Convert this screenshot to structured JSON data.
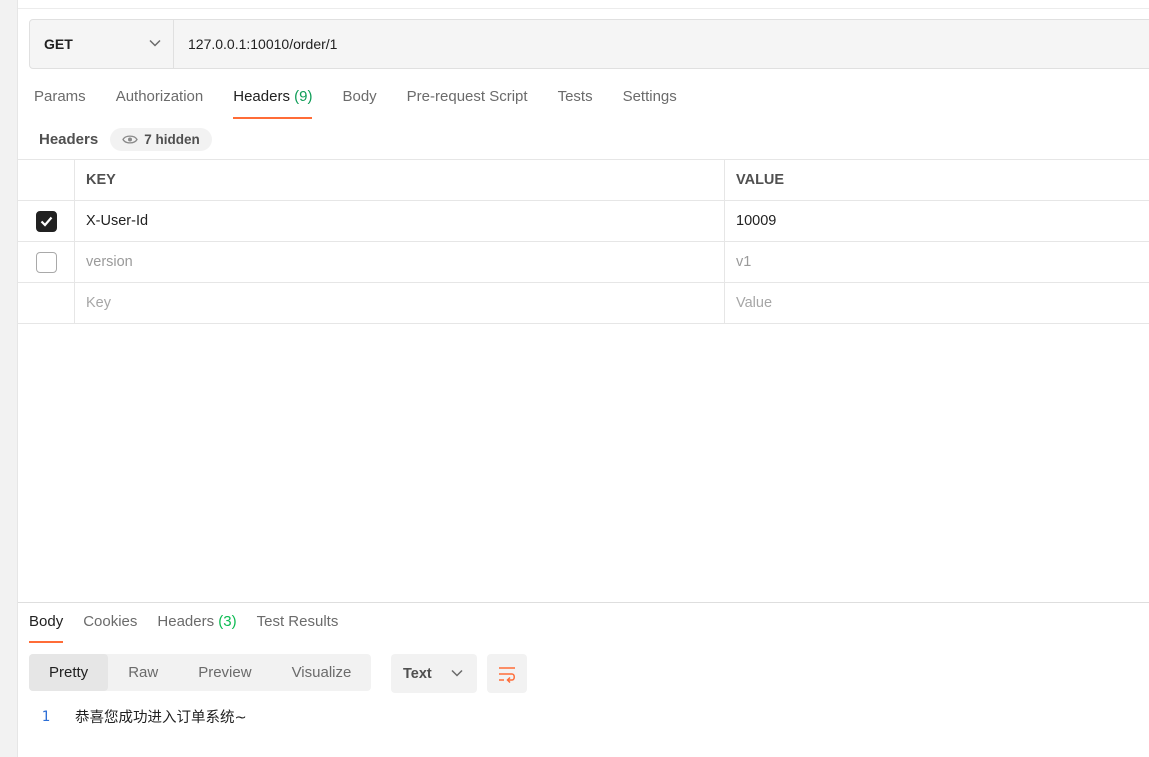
{
  "request": {
    "method": "GET",
    "url": "127.0.0.1:10010/order/1"
  },
  "request_tabs": [
    {
      "label": "Params",
      "count": ""
    },
    {
      "label": "Authorization",
      "count": ""
    },
    {
      "label": "Headers",
      "count": "(9)"
    },
    {
      "label": "Body",
      "count": ""
    },
    {
      "label": "Pre-request Script",
      "count": ""
    },
    {
      "label": "Tests",
      "count": ""
    },
    {
      "label": "Settings",
      "count": ""
    }
  ],
  "active_request_tab": "Headers",
  "headers_section": {
    "title": "Headers",
    "hidden_label": "7 hidden"
  },
  "headers_table": {
    "columns": [
      "KEY",
      "VALUE"
    ],
    "rows": [
      {
        "checked": true,
        "key": "X-User-Id",
        "value": "10009"
      },
      {
        "checked": false,
        "key": "version",
        "value": "v1"
      }
    ],
    "placeholders": {
      "key": "Key",
      "value": "Value"
    }
  },
  "response_tabs": [
    {
      "label": "Body",
      "count": ""
    },
    {
      "label": "Cookies",
      "count": ""
    },
    {
      "label": "Headers",
      "count": "(3)"
    },
    {
      "label": "Test Results",
      "count": ""
    }
  ],
  "view_modes": [
    "Pretty",
    "Raw",
    "Preview",
    "Visualize"
  ],
  "active_view_mode": "Pretty",
  "format": "Text",
  "response_body": {
    "line_number": "1",
    "text": "恭喜您成功进入订单系统~"
  },
  "colors": {
    "accent": "#ff6c37",
    "count_green": "#0cbb52",
    "line_number_blue": "#2d6fd6"
  }
}
